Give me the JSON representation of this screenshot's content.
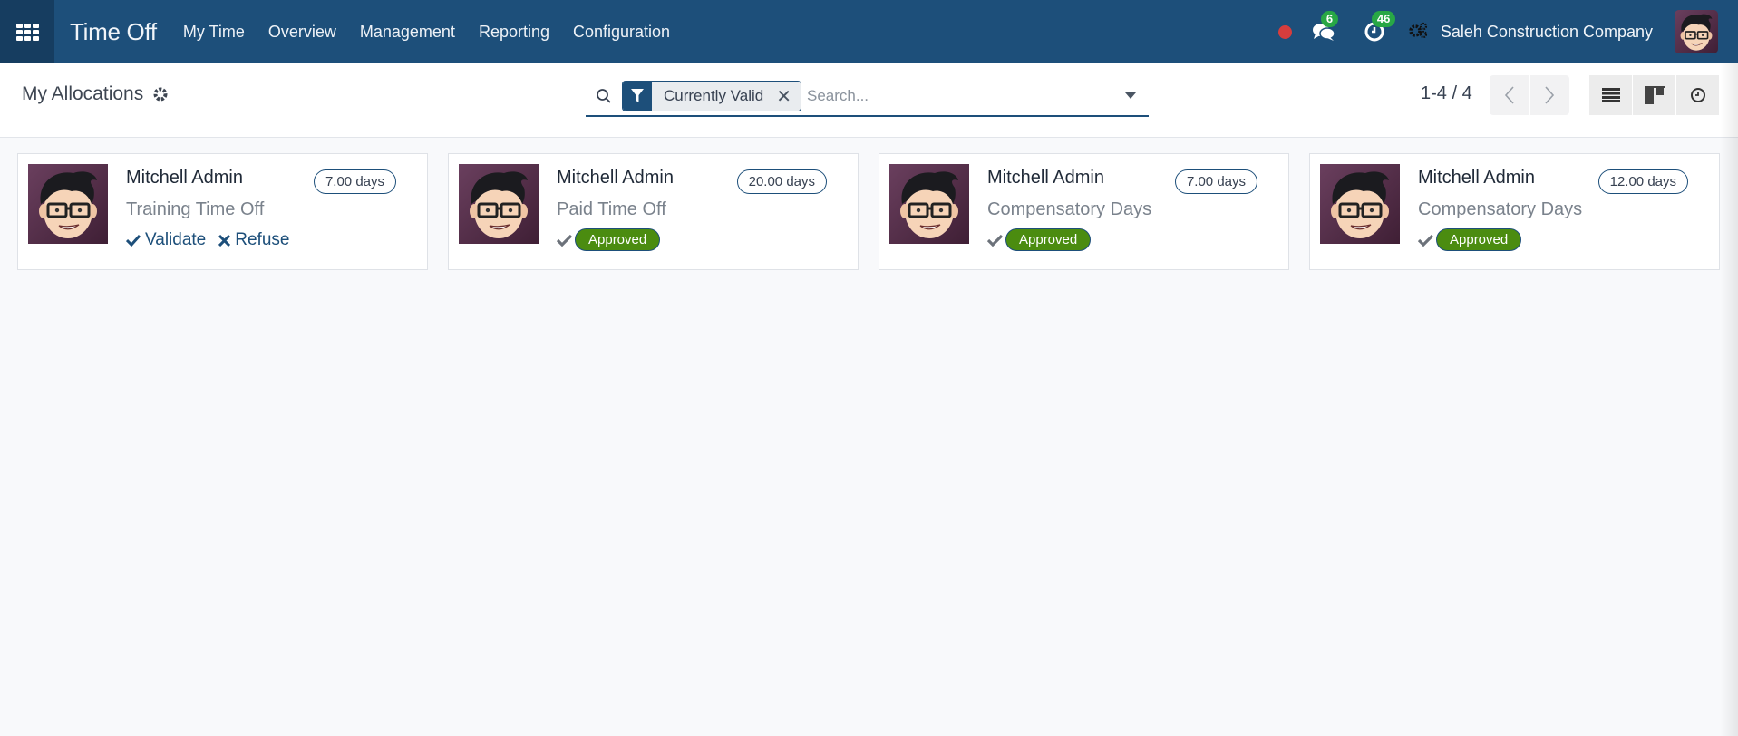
{
  "navbar": {
    "app_title": "Time Off",
    "menu": [
      {
        "label": "My Time"
      },
      {
        "label": "Overview"
      },
      {
        "label": "Management"
      },
      {
        "label": "Reporting"
      },
      {
        "label": "Configuration"
      }
    ],
    "messages_count": "6",
    "activities_count": "46",
    "company": "Saleh Construction Company",
    "colors": {
      "navbar": "#1d4f7a",
      "badge": "#28a745",
      "recording": "#d63d3d"
    }
  },
  "control_panel": {
    "breadcrumb": "My Allocations",
    "search": {
      "facet_label": "Currently Valid",
      "placeholder": "Search...",
      "value": ""
    },
    "pager": "1-4 / 4",
    "views": [
      "list-view",
      "kanban-view",
      "activity-view"
    ]
  },
  "cards": [
    {
      "employee": "Mitchell Admin",
      "duration": "7.00 days",
      "leave_type": "Training Time Off",
      "state": "to_approve",
      "actions": {
        "validate": "Validate",
        "refuse": "Refuse"
      }
    },
    {
      "employee": "Mitchell Admin",
      "duration": "20.00 days",
      "leave_type": "Paid Time Off",
      "state": "approved",
      "status_label": "Approved"
    },
    {
      "employee": "Mitchell Admin",
      "duration": "7.00 days",
      "leave_type": "Compensatory Days",
      "state": "approved",
      "status_label": "Approved"
    },
    {
      "employee": "Mitchell Admin",
      "duration": "12.00 days",
      "leave_type": "Compensatory Days",
      "state": "approved",
      "status_label": "Approved"
    }
  ],
  "colors": {
    "approved_badge": "#4b8c10",
    "primary": "#1d4f7a"
  }
}
